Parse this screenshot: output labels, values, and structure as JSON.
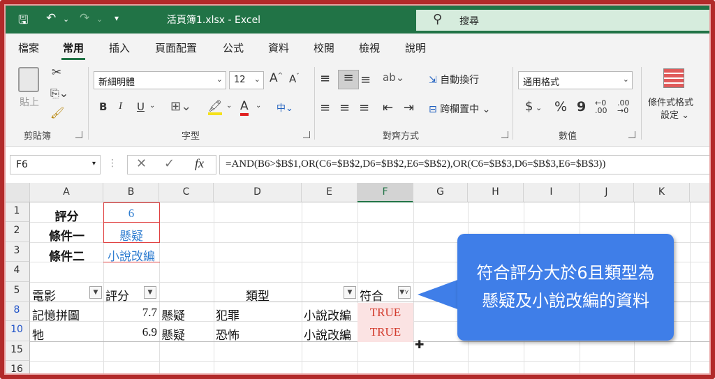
{
  "window": {
    "title": "活頁簿1.xlsx  -  Excel",
    "search_label": "搜尋"
  },
  "menu": [
    "檔案",
    "常用",
    "插入",
    "頁面配置",
    "公式",
    "資料",
    "校閱",
    "檢視",
    "說明"
  ],
  "ribbon": {
    "clipboard": {
      "paste": "貼上",
      "group": "剪貼簿"
    },
    "font": {
      "name": "新細明體",
      "size": "12",
      "group": "字型",
      "bold": "B",
      "italic": "I",
      "underline": "U"
    },
    "align": {
      "wrap": "自動換行",
      "merge": "跨欄置中",
      "group": "對齊方式"
    },
    "number": {
      "format": "通用格式",
      "currency": "$",
      "percent": "%",
      "comma": "9",
      "group": "數值"
    },
    "styles": {
      "cond_format_line1": "條件式格式",
      "cond_format_line2": "設定"
    }
  },
  "formula_bar": {
    "name_box": "F6",
    "fx": "fx",
    "formula": "=AND(B6>$B$1,OR(C6=$B$2,D6=$B$2,E6=$B$2),OR(C6=$B$3,D6=$B$3,E6=$B$3))"
  },
  "columns": [
    "A",
    "B",
    "C",
    "D",
    "E",
    "F",
    "G",
    "H",
    "I",
    "J",
    "K"
  ],
  "rows": [
    "1",
    "2",
    "3",
    "4",
    "5",
    "8",
    "10",
    "15",
    "16"
  ],
  "cells": {
    "a1": "評分",
    "b1": "6",
    "a2": "條件一",
    "b2": "懸疑",
    "a3": "條件二",
    "b3": "小說改編",
    "a5": "電影",
    "b5": "評分",
    "d5": "類型",
    "f5": "符合",
    "a8": "記憶拼圖",
    "b8": "7.7",
    "c8": "懸疑",
    "d8": "犯罪",
    "e8": "小說改編",
    "f8": "TRUE",
    "a10": "牠",
    "b10": "6.9",
    "c10": "懸疑",
    "d10": "恐怖",
    "e10": "小說改編",
    "f10": "TRUE"
  },
  "callout": {
    "line1": "符合評分大於6且類型為",
    "line2": "懸疑及小說改編的資料"
  }
}
